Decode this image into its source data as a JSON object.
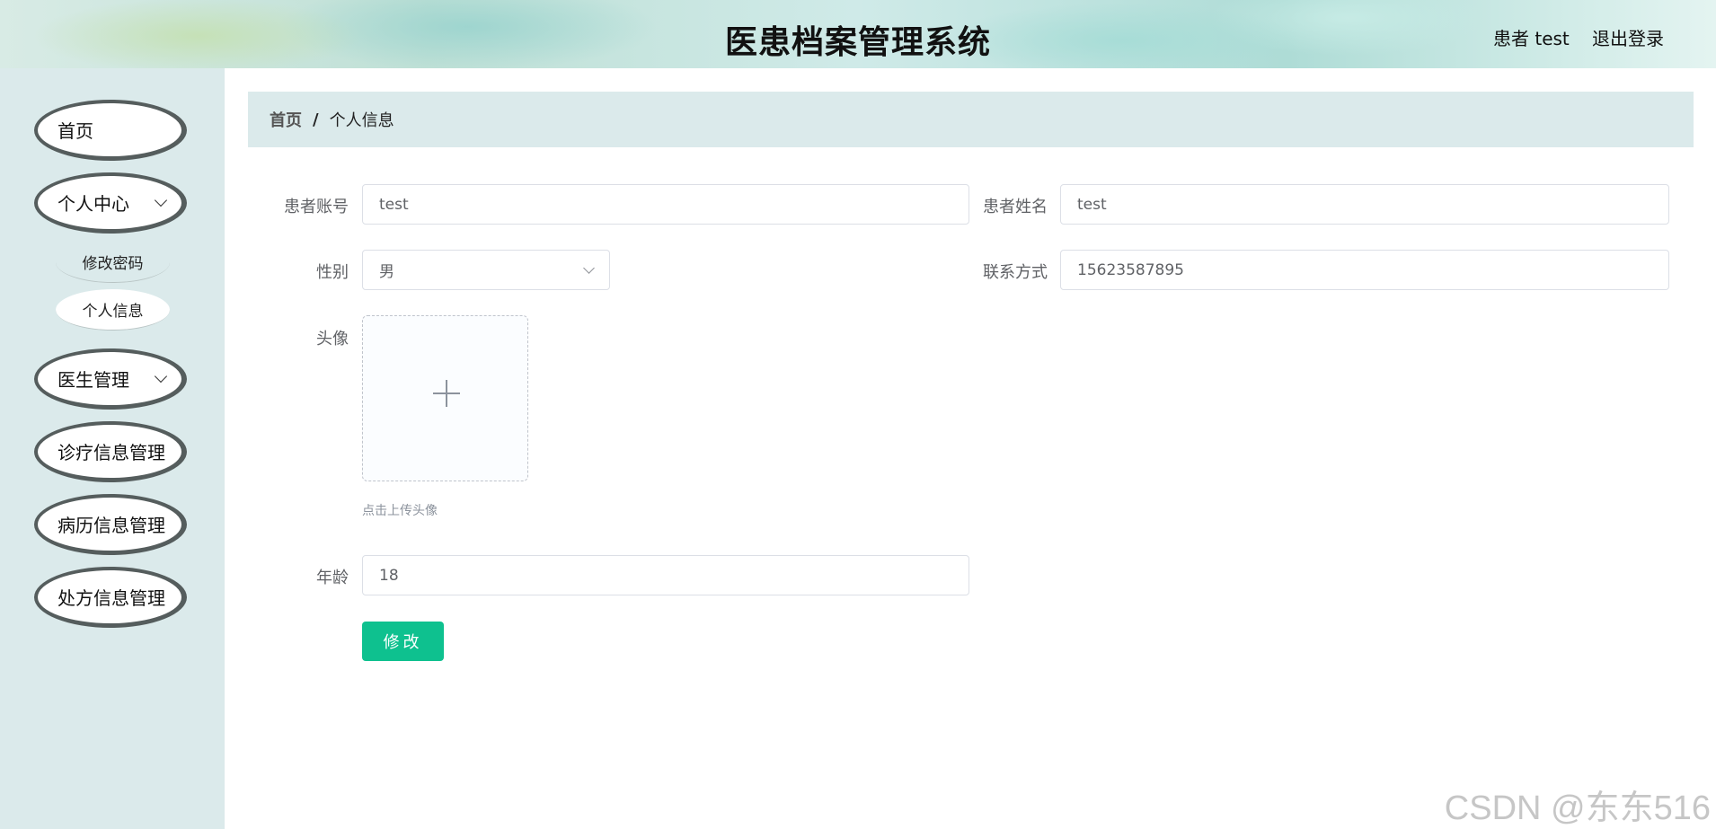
{
  "header": {
    "title": "医患档案管理系统",
    "user": "患者 test",
    "logout": "退出登录"
  },
  "sidebar": {
    "items": [
      {
        "label": "首页"
      },
      {
        "label": "个人中心",
        "children": [
          {
            "label": "修改密码"
          },
          {
            "label": "个人信息"
          }
        ]
      },
      {
        "label": "医生管理"
      },
      {
        "label": "诊疗信息管理"
      },
      {
        "label": "病历信息管理"
      },
      {
        "label": "处方信息管理"
      }
    ]
  },
  "breadcrumb": {
    "home": "首页",
    "separator": "/",
    "current": "个人信息"
  },
  "form": {
    "account": {
      "label": "患者账号",
      "value": "test"
    },
    "name": {
      "label": "患者姓名",
      "value": "test"
    },
    "gender": {
      "label": "性别",
      "value": "男"
    },
    "phone": {
      "label": "联系方式",
      "value": "15623587895"
    },
    "avatar": {
      "label": "头像",
      "tip": "点击上传头像"
    },
    "age": {
      "label": "年龄",
      "value": "18"
    },
    "submit_label": "修改"
  },
  "watermark": "CSDN @东东516",
  "colors": {
    "primary_button": "#0ec18f",
    "sidebar_bg": "#dbeaeb"
  }
}
